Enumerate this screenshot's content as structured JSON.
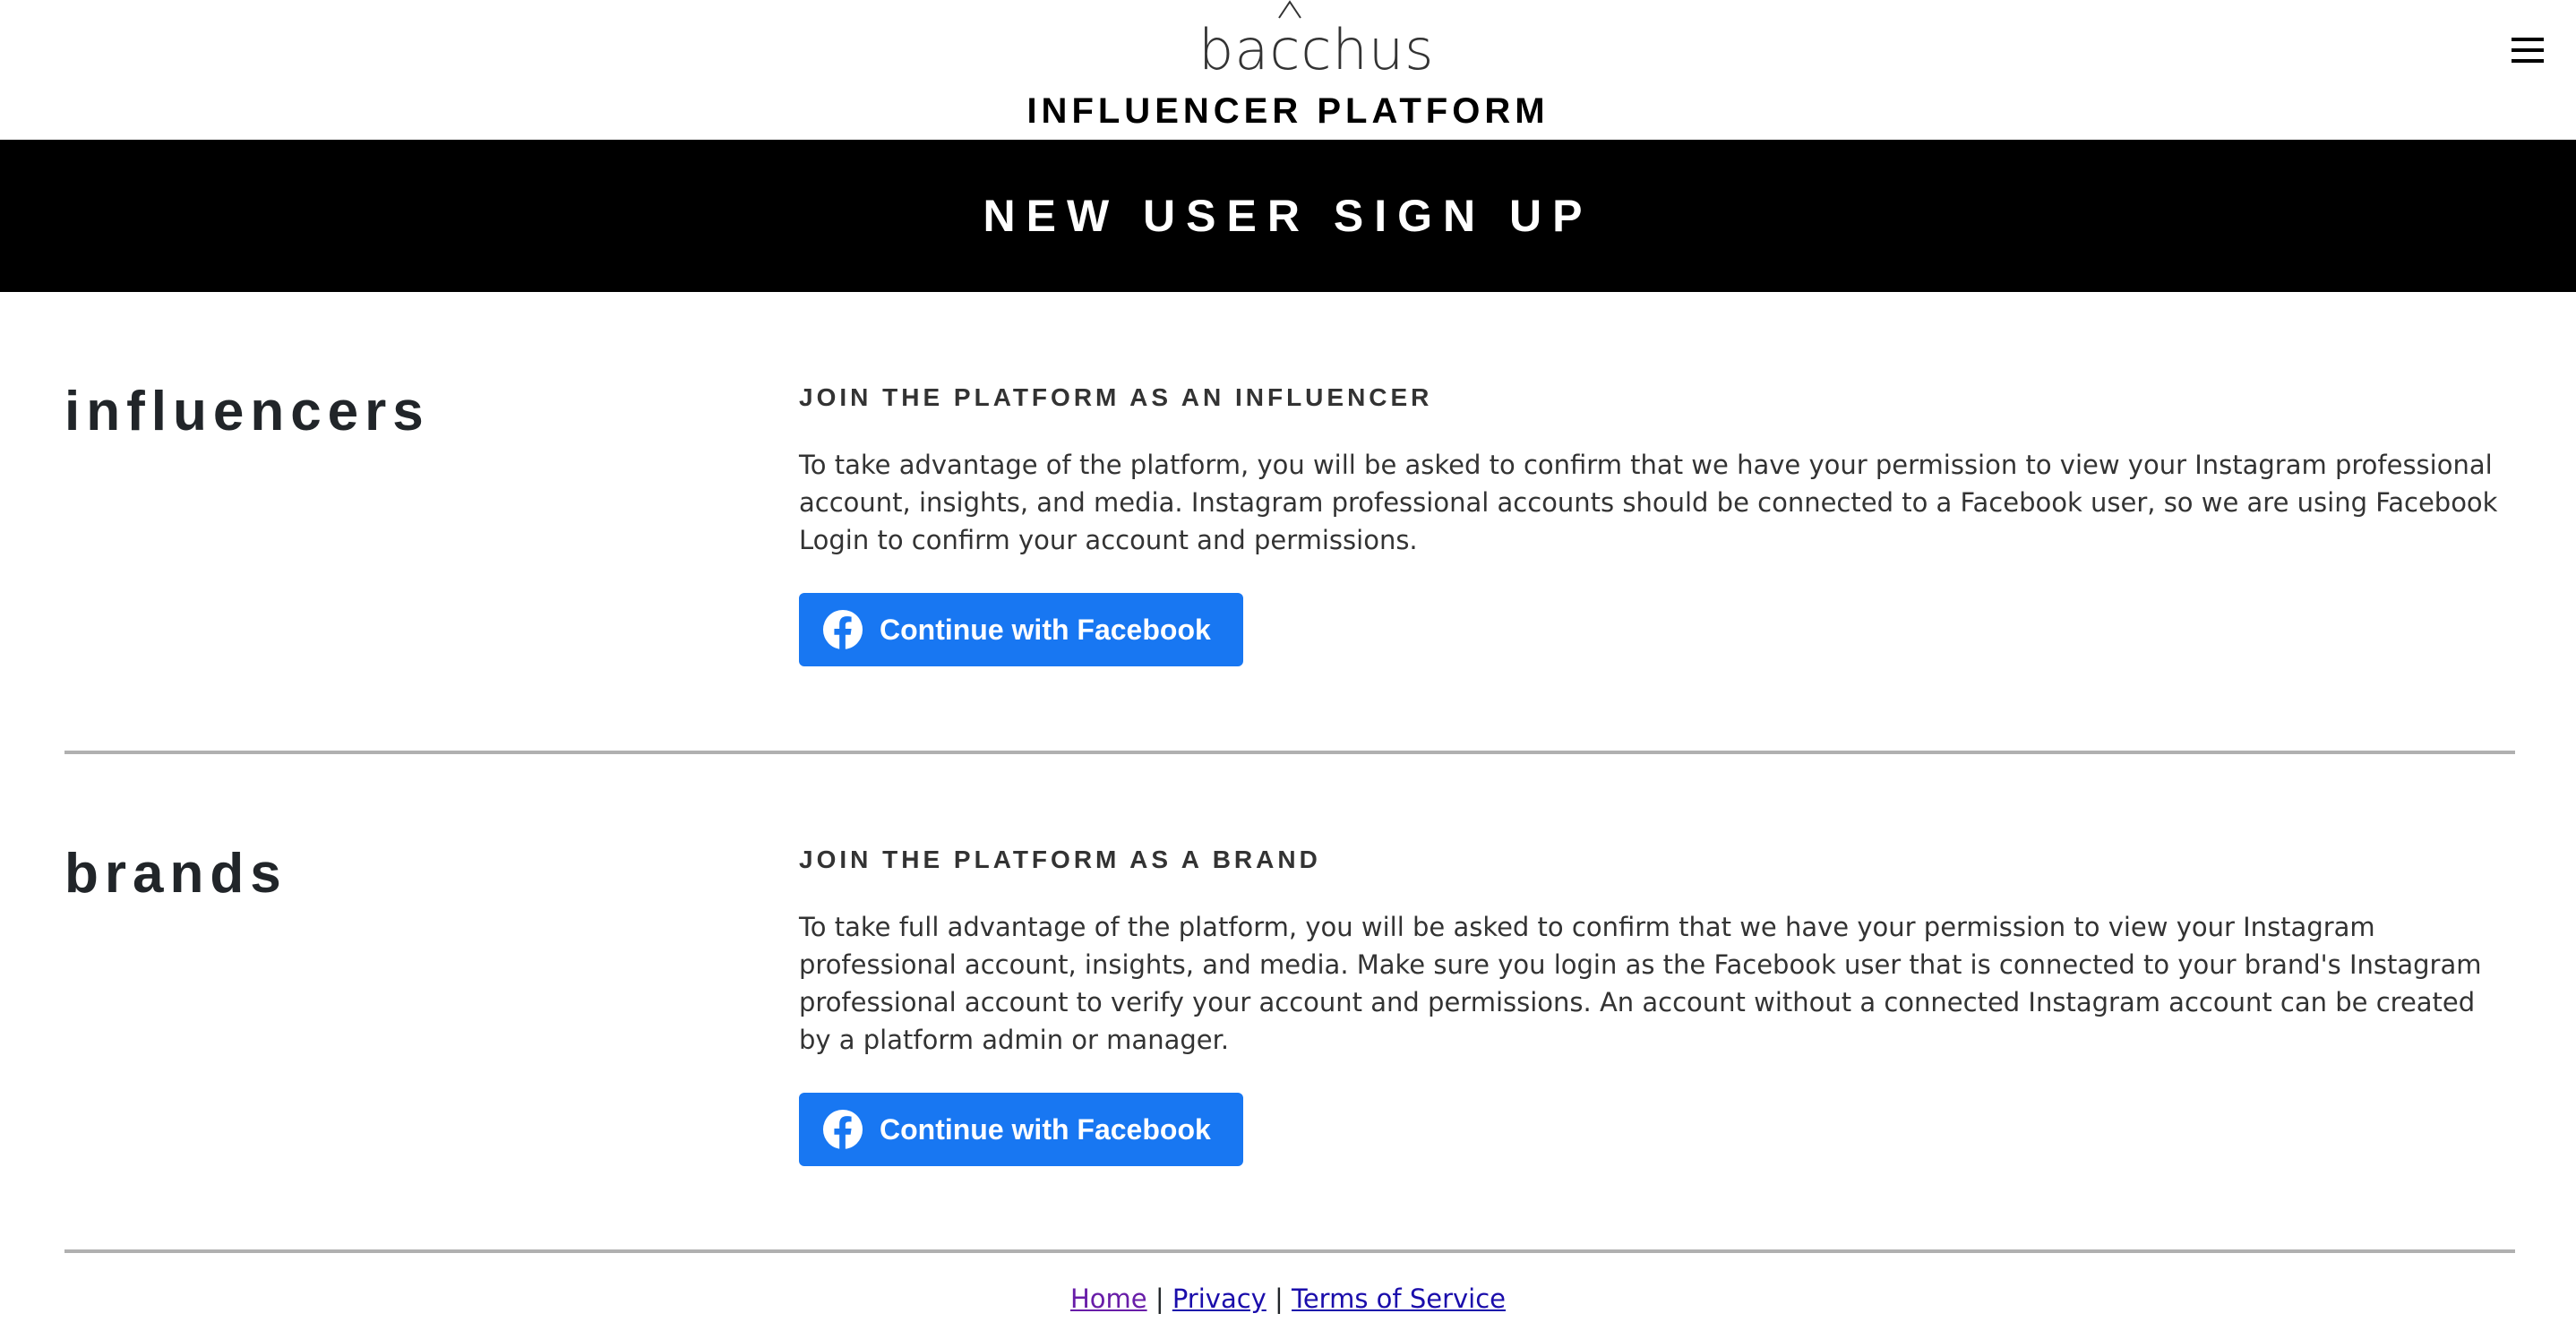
{
  "header": {
    "logo_text": "bacchus",
    "platform_title": "INFLUENCER PLATFORM"
  },
  "banner": {
    "title": "NEW USER SIGN UP"
  },
  "sections": [
    {
      "heading": "influencers",
      "sub_heading": "JOIN THE PLATFORM AS AN INFLUENCER",
      "description": "To take advantage of the platform, you will be asked to confirm that we have your permission to view your Instagram professional account, insights, and media. Instagram professional accounts should be connected to a Facebook user, so we are using Facebook Login to confirm your account and permissions.",
      "button_label": "Continue with Facebook"
    },
    {
      "heading": "brands",
      "sub_heading": "JOIN THE PLATFORM AS A BRAND",
      "description": "To take full advantage of the platform, you will be asked to confirm that we have your permission to view your Instagram professional account, insights, and media. Make sure you login as the Facebook user that is connected to your brand's Instagram professional account to verify your account and permissions. An account without a connected Instagram account can be created by a platform admin or manager.",
      "button_label": "Continue with Facebook"
    }
  ],
  "footer": {
    "links": [
      {
        "label": "Home"
      },
      {
        "label": "Privacy"
      },
      {
        "label": "Terms of Service"
      }
    ],
    "separator": "|"
  },
  "colors": {
    "facebook_blue": "#1877f2",
    "banner_bg": "#000000",
    "divider": "#b0b0b0",
    "link": "#1a0dab",
    "visited_link": "#681da8"
  },
  "icons": {
    "menu": "hamburger-menu-icon",
    "logo_mark": "chevron-up-icon",
    "facebook": "facebook-logo-icon"
  }
}
